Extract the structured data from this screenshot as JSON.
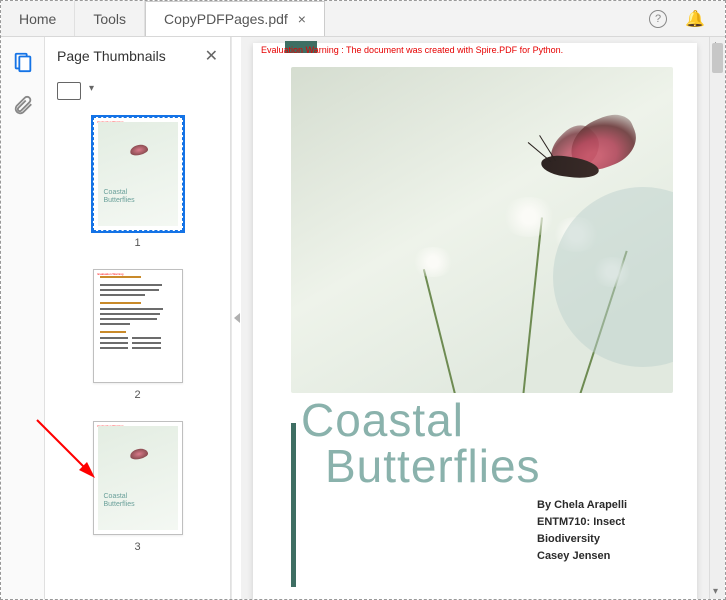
{
  "tabs": {
    "home": "Home",
    "tools": "Tools",
    "doc": "CopyPDFPages.pdf"
  },
  "panel": {
    "title": "Page Thumbnails",
    "pages": [
      "1",
      "2",
      "3"
    ]
  },
  "document": {
    "warning": "Evaluation Warning : The document was created with Spire.PDF for Python.",
    "title_line1": "Coastal",
    "title_line2": "Butterflies",
    "meta": {
      "author": "By Chela Arapelli",
      "course": "ENTM710: Insect Biodiversity",
      "instructor": "Casey Jensen"
    }
  },
  "thumb_cover": {
    "t1": "Coastal",
    "t2": "Butterflies"
  }
}
